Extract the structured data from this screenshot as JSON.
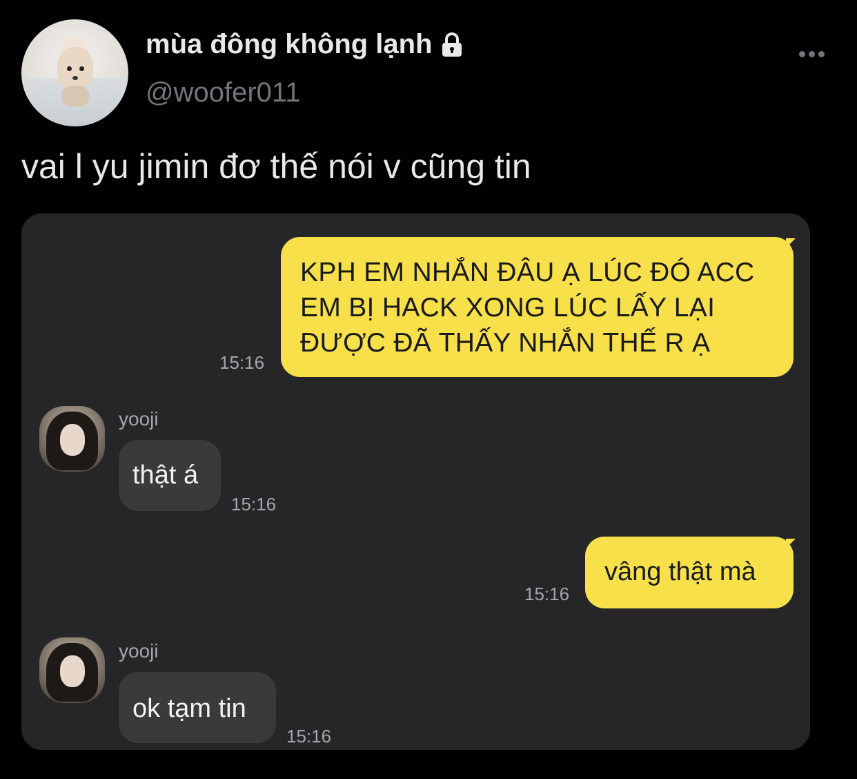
{
  "tweet": {
    "display_name": "mùa đông không lạnh",
    "handle": "@woofer011",
    "text": "vai l yu jimin đơ thế nói v cũng tin",
    "icons": {
      "verified_lock": "lock-icon",
      "more": "more-icon"
    }
  },
  "chat": {
    "messages": [
      {
        "sender": "me",
        "text": "KPH EM NHẮN ĐÂU Ạ LÚC ĐÓ ACC\nEM BỊ HACK XONG LÚC LẤY LẠI\nĐƯỢC ĐÃ THẤY NHẮN THẾ R Ạ",
        "time": "15:16"
      },
      {
        "sender": "yooji",
        "text": "thật á",
        "time": "15:16"
      },
      {
        "sender": "me",
        "text": "vâng thật mà",
        "time": "15:16"
      },
      {
        "sender": "yooji",
        "text": "ok tạm tin",
        "time": "15:16"
      }
    ],
    "colors": {
      "my_bubble": "#f8e04a",
      "their_bubble": "#3a3a3c",
      "panel": "#262628"
    }
  }
}
